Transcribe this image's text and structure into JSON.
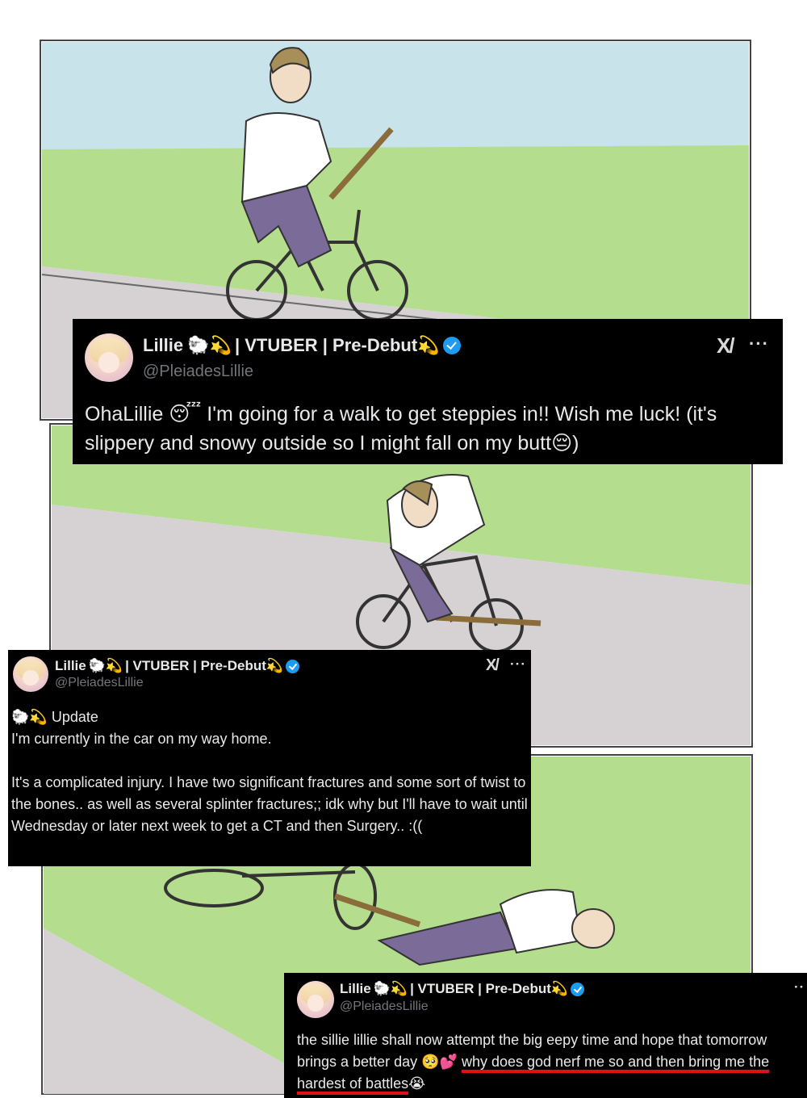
{
  "tweets": [
    {
      "name": "Lillie",
      "name_suffix": "| VTUBER | Pre-Debut",
      "handle": "@PleiadesLillie",
      "text_parts": [
        "OhaLillie ",
        " I'm going for a walk to get steppies in!! Wish me luck! (it's slippery and snowy outside so I might fall on my butt",
        ")"
      ]
    },
    {
      "name": "Lillie",
      "name_suffix": "| VTUBER | Pre-Debut",
      "handle": "@PleiadesLillie",
      "update_label": "Update",
      "line1": "I'm currently in the car on my way home.",
      "line2": "It's a complicated injury. I have two significant fractures and some sort of twist to the bones.. as well as several splinter fractures;; idk why but I'll have to wait until Wednesday or later next week to get a CT and then Surgery.. :(("
    },
    {
      "name": "Lillie",
      "name_suffix": "| VTUBER | Pre-Debut",
      "handle": "@PleiadesLillie",
      "text_a": "the sillie lillie shall now attempt the big eepy time and hope that tomorrow brings a better day ",
      "text_b": "why does god nerf me so and then bring me the hardest of battles"
    }
  ],
  "icons": {
    "x_logo": "x-logo-icon",
    "more": "more-options-icon",
    "verified": "verified-badge-icon"
  },
  "colors": {
    "sky": "#c9e3ea",
    "grass": "#b5dd8e",
    "road": "#d6d2d4",
    "tweet_bg": "#000000",
    "verified": "#1d9bf0",
    "underline": "#e0101a"
  }
}
